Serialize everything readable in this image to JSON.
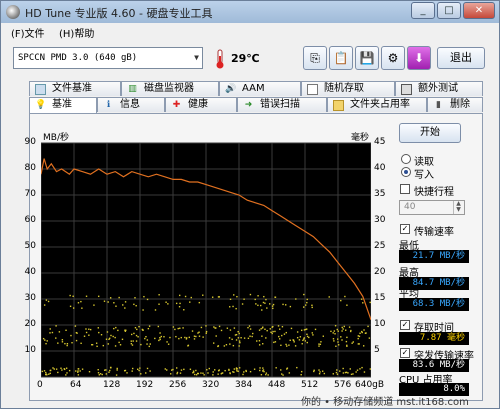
{
  "window": {
    "title": "HD Tune 专业版 4.60 - 硬盘专业工具",
    "watermark": "你的 • 移动存储频道 mst.it168.com",
    "buttons": {
      "minimize": "_",
      "maximize": "□",
      "close": "✕"
    }
  },
  "menu": {
    "file": "(F)文件",
    "help": "(H)帮助"
  },
  "toolbar": {
    "drive": "SPCCN    PMD 3.0 (640 gB)",
    "temperature": "29℃",
    "exit": "退出"
  },
  "tabs_top": [
    {
      "label": "文件基准",
      "icon": "file-benchmark-icon"
    },
    {
      "label": "磁盘监视器",
      "icon": "disk-monitor-icon"
    },
    {
      "label": "AAM",
      "icon": "speaker-icon"
    },
    {
      "label": "随机存取",
      "icon": "random-access-icon"
    },
    {
      "label": "额外测试",
      "icon": "extra-tests-icon"
    }
  ],
  "tabs_bottom": [
    {
      "label": "基准",
      "icon": "benchmark-icon"
    },
    {
      "label": "信息",
      "icon": "info-icon"
    },
    {
      "label": "健康",
      "icon": "health-icon"
    },
    {
      "label": "错误扫描",
      "icon": "error-scan-icon"
    },
    {
      "label": "文件夹占用率",
      "icon": "folder-usage-icon"
    },
    {
      "label": "删除",
      "icon": "erase-icon"
    }
  ],
  "side": {
    "start": "开始",
    "read": "读取",
    "write": "写入",
    "quick_test": "快捷行程",
    "quick_value": "40",
    "transfer_rate": "传输速率",
    "min_label": "最低",
    "min_value": "21.7 MB/秒",
    "max_label": "最高",
    "max_value": "84.7 MB/秒",
    "avg_label": "平均",
    "avg_value": "68.3 MB/秒",
    "access_time": "存取时间",
    "access_value": "7.87 毫秒",
    "burst_rate": "突发传输速率",
    "burst_value": "83.6 MB/秒",
    "cpu_label": "CPU 占用率",
    "cpu_value": "8.0%"
  },
  "colors": {
    "chart_bg": "#000000",
    "grid": "#3a3a3a",
    "transfer_line": "#e07020",
    "access_dots": "#d8c830"
  },
  "chart_data": {
    "type": "line",
    "ylabel_left": "MB/秒",
    "ylabel_right": "毫秒",
    "x_ticks": [
      "0",
      "64",
      "128",
      "192",
      "256",
      "320",
      "384",
      "448",
      "512",
      "576",
      "640gB"
    ],
    "y_left_ticks": [
      "90",
      "80",
      "70",
      "60",
      "50",
      "40",
      "30",
      "20",
      "10"
    ],
    "y_right_ticks": [
      "45",
      "40",
      "35",
      "30",
      "25",
      "20",
      "15",
      "10",
      "5"
    ],
    "xlim": [
      0,
      640
    ],
    "ylim_left": [
      0,
      90
    ],
    "ylim_right": [
      0,
      45
    ],
    "grid": true,
    "series": [
      {
        "type": "line",
        "x": [
          0,
          6,
          12,
          20,
          30,
          40,
          55,
          64,
          80,
          96,
          112,
          128,
          144,
          160,
          176,
          192,
          208,
          224,
          240,
          256,
          272,
          288,
          304,
          320,
          336,
          352,
          368,
          384,
          400,
          416,
          432,
          448,
          464,
          480,
          496,
          512,
          528,
          544,
          560,
          576,
          592,
          608,
          624,
          640
        ],
        "y": [
          78,
          84,
          80,
          82,
          79,
          80,
          78,
          80,
          79,
          78,
          80,
          78,
          79,
          77,
          79,
          78,
          77,
          78,
          77,
          76,
          76,
          75,
          75,
          74,
          73,
          72,
          71,
          70,
          68,
          67,
          66,
          64,
          62,
          60,
          58,
          56,
          54,
          51,
          48,
          44,
          40,
          36,
          31,
          22
        ]
      }
    ],
    "access_time_scatter": {
      "bands_ms": [
        [
          13,
          16
        ],
        [
          6,
          10
        ],
        [
          0.5,
          2
        ]
      ],
      "x_range": [
        0,
        640
      ]
    }
  }
}
